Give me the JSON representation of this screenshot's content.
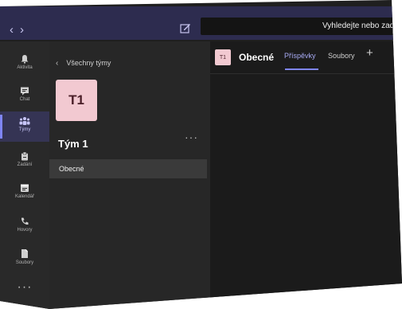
{
  "titlebar": {
    "back_glyph": "‹",
    "forward_glyph": "›",
    "search_placeholder": "Vyhledejte nebo zadej"
  },
  "rail": {
    "items": [
      {
        "label": "Aktivita",
        "icon": "bell-icon"
      },
      {
        "label": "Chat",
        "icon": "chat-icon"
      },
      {
        "label": "Týmy",
        "icon": "teams-icon"
      },
      {
        "label": "Zadání",
        "icon": "assignments-icon"
      },
      {
        "label": "Kalendář",
        "icon": "calendar-icon"
      },
      {
        "label": "Hovory",
        "icon": "phone-icon"
      },
      {
        "label": "Soubory",
        "icon": "files-icon"
      }
    ],
    "more": "···"
  },
  "panel": {
    "back_label": "Všechny týmy",
    "team_initials": "T1",
    "team_name": "Tým 1",
    "more": "···",
    "channel": "Obecné"
  },
  "main": {
    "channel_initials": "T1",
    "channel_title": "Obecné",
    "tabs": [
      "Příspěvky",
      "Soubory"
    ],
    "add": "+"
  },
  "colors": {
    "accent": "#7f85f5",
    "titlebar": "#2d2c4f",
    "team_avatar": "#f2c9d1"
  }
}
